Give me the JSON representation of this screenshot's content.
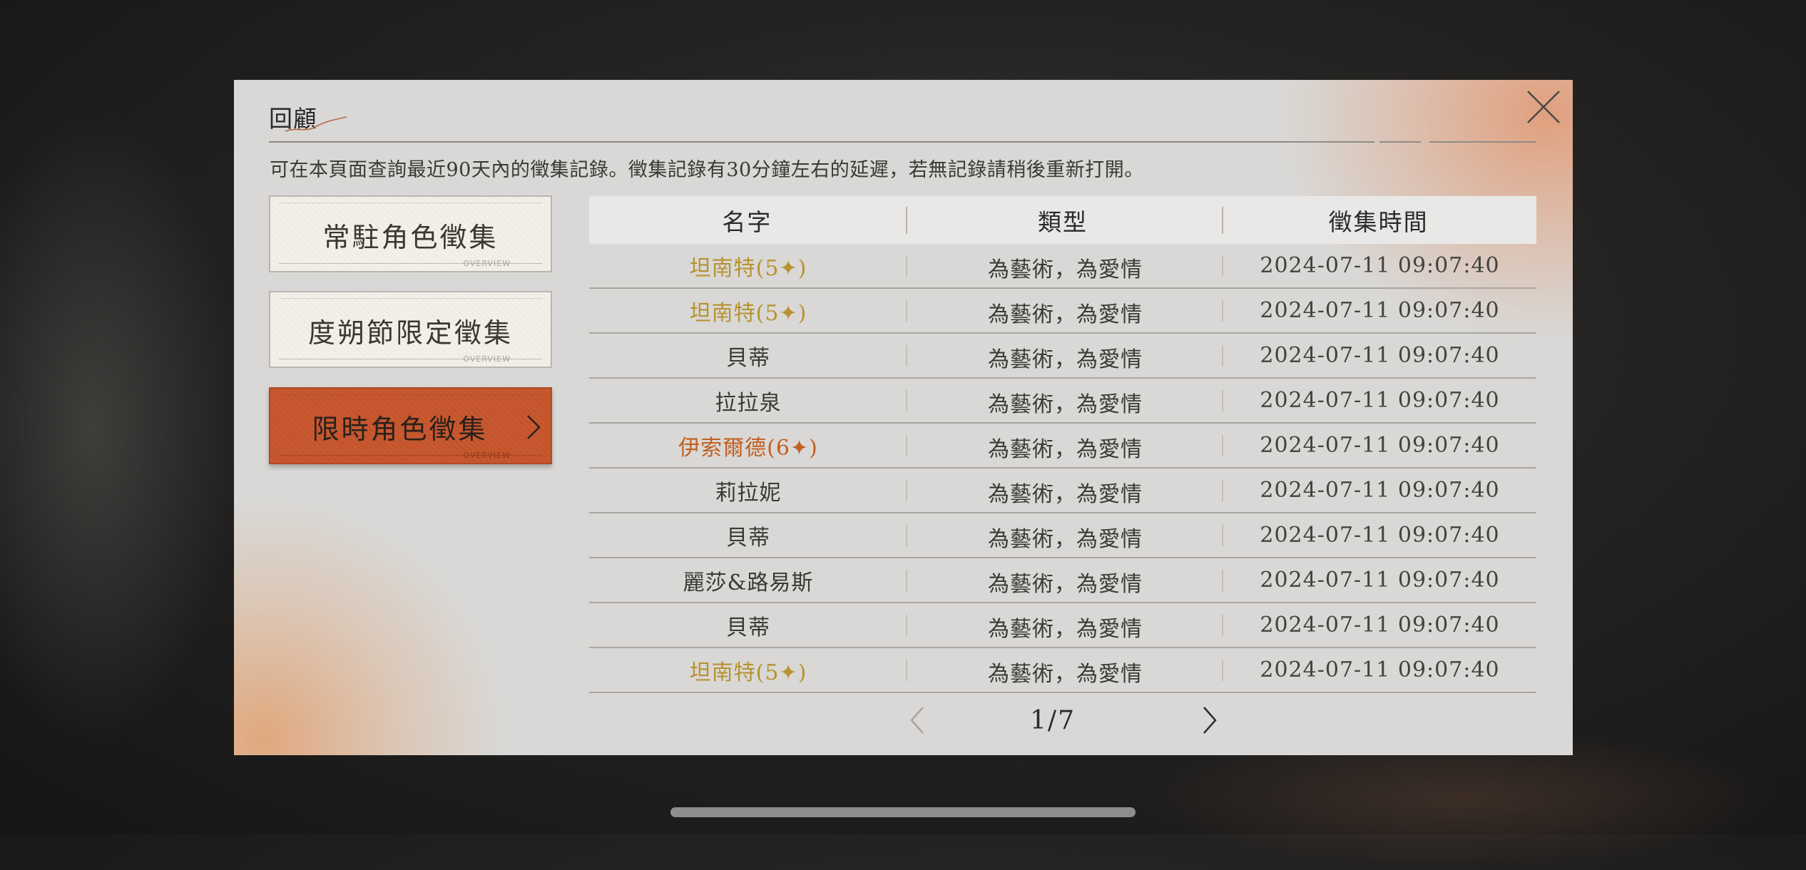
{
  "dialog": {
    "title": "回顧",
    "description": "可在本頁面查詢最近90天內的徵集記錄。徵集記錄有30分鐘左右的延遲，若無記錄請稍後重新打開。",
    "close_icon": "close-icon"
  },
  "tabs": [
    {
      "label": "常駐角色徵集",
      "deco": "OVERVIEW",
      "active": false
    },
    {
      "label": "度朔節限定徵集",
      "deco": "OVERVIEW",
      "active": false
    },
    {
      "label": "限時角色徵集",
      "deco": "OVERVIEW",
      "active": true
    }
  ],
  "table": {
    "headers": [
      "名字",
      "類型",
      "徵集時間"
    ],
    "rows": [
      {
        "name": "坦南特(5✦)",
        "rarity": 5,
        "type": "為藝術，為愛情",
        "time": "2024-07-11 09:07:40"
      },
      {
        "name": "坦南特(5✦)",
        "rarity": 5,
        "type": "為藝術，為愛情",
        "time": "2024-07-11 09:07:40"
      },
      {
        "name": "貝蒂",
        "rarity": 0,
        "type": "為藝術，為愛情",
        "time": "2024-07-11 09:07:40"
      },
      {
        "name": "拉拉泉",
        "rarity": 0,
        "type": "為藝術，為愛情",
        "time": "2024-07-11 09:07:40"
      },
      {
        "name": "伊索爾德(6✦)",
        "rarity": 6,
        "type": "為藝術，為愛情",
        "time": "2024-07-11 09:07:40"
      },
      {
        "name": "莉拉妮",
        "rarity": 0,
        "type": "為藝術，為愛情",
        "time": "2024-07-11 09:07:40"
      },
      {
        "name": "貝蒂",
        "rarity": 0,
        "type": "為藝術，為愛情",
        "time": "2024-07-11 09:07:40"
      },
      {
        "name": "麗莎&路易斯",
        "rarity": 0,
        "type": "為藝術，為愛情",
        "time": "2024-07-11 09:07:40"
      },
      {
        "name": "貝蒂",
        "rarity": 0,
        "type": "為藝術，為愛情",
        "time": "2024-07-11 09:07:40"
      },
      {
        "name": "坦南特(5✦)",
        "rarity": 5,
        "type": "為藝術，為愛情",
        "time": "2024-07-11 09:07:40"
      }
    ]
  },
  "pager": {
    "label": "1/7",
    "prev_icon": "chevron-left-icon",
    "next_icon": "chevron-right-icon"
  },
  "colors": {
    "rarity5": "#b7922f",
    "rarity6": "#c25f22",
    "active_tab": "#c9582f",
    "panel": "#d9d8d6"
  }
}
